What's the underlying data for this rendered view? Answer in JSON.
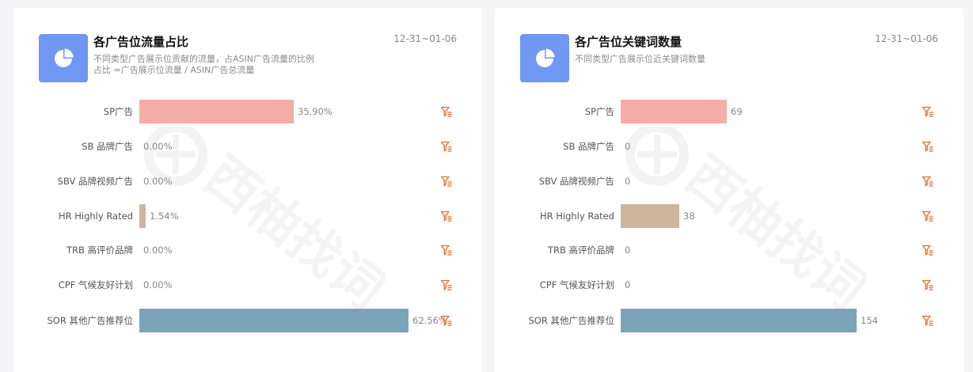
{
  "colors": {
    "sp": "#f4aea7",
    "sb": "#f4aea7",
    "sbv": "#f4aea7",
    "hr": "#ccb6a0",
    "trb": "#ccb6a0",
    "cpf": "#ccb6a0",
    "sor": "#7ba4b8",
    "icon_bg": "#6f97f4",
    "filter_icon": "#e96b2e"
  },
  "left_panel": {
    "title": "各广告位流量占比",
    "date_range": "12-31~01-06",
    "desc_line1": "不同类型广告展示位贡献的流量，占ASIN广告流量的比例",
    "desc_line2": "占比 =广告展示位流量 / ASIN广告总流量",
    "rows": [
      {
        "label": "SP广告",
        "value": "35.90%",
        "share": 35.9,
        "color_key": "sp"
      },
      {
        "label": "SB 品牌广告",
        "value": "0.00%",
        "share": 0,
        "color_key": "sb"
      },
      {
        "label": "SBV 品牌视频广告",
        "value": "0.00%",
        "share": 0,
        "color_key": "sbv"
      },
      {
        "label": "HR Highly Rated",
        "value": "1.54%",
        "share": 1.54,
        "color_key": "hr"
      },
      {
        "label": "TRB 高评价品牌",
        "value": "0.00%",
        "share": 0,
        "color_key": "trb"
      },
      {
        "label": "CPF 气候友好计划",
        "value": "0.00%",
        "share": 0,
        "color_key": "cpf"
      },
      {
        "label": "SOR 其他广告推荐位",
        "value": "62.56%",
        "share": 62.56,
        "color_key": "sor"
      }
    ]
  },
  "right_panel": {
    "title": "各广告位关键词数量",
    "date_range": "12-31~01-06",
    "desc_line1": "不同类型广告展示位近关键词数量",
    "rows": [
      {
        "label": "SP广告",
        "value": "69",
        "count": 69,
        "color_key": "sp"
      },
      {
        "label": "SB 品牌广告",
        "value": "0",
        "count": 0,
        "color_key": "sb"
      },
      {
        "label": "SBV 品牌视频广告",
        "value": "0",
        "count": 0,
        "color_key": "sbv"
      },
      {
        "label": "HR Highly Rated",
        "value": "38",
        "count": 38,
        "color_key": "hr"
      },
      {
        "label": "TRB 高评价品牌",
        "value": "0",
        "count": 0,
        "color_key": "trb"
      },
      {
        "label": "CPF 气候友好计划",
        "value": "0",
        "count": 0,
        "color_key": "cpf"
      },
      {
        "label": "SOR 其他广告推荐位",
        "value": "154",
        "count": 154,
        "color_key": "sor"
      }
    ]
  },
  "watermark_text": "西柚找词",
  "icons": {
    "header": "pie-chart-icon",
    "row_action": "filter-list-icon"
  }
}
